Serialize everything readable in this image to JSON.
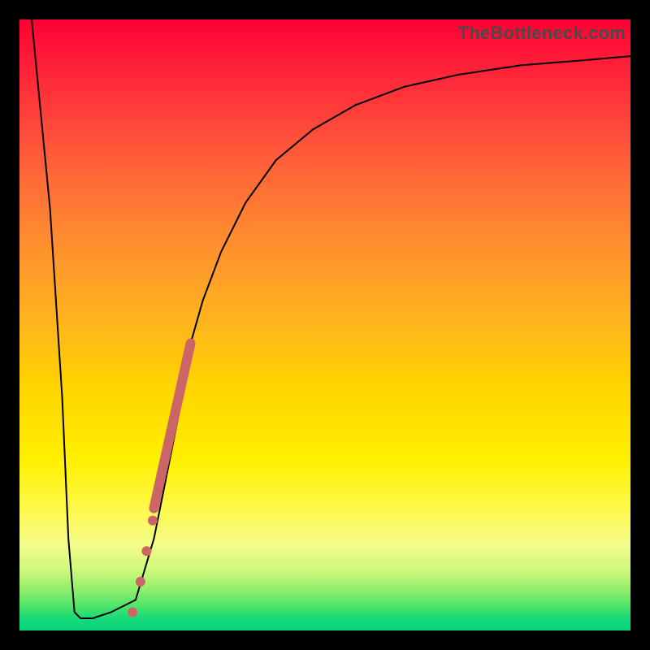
{
  "watermark": "TheBottleneck.com",
  "chart_data": {
    "type": "line",
    "title": "",
    "xlabel": "",
    "ylabel": "",
    "xlim": [
      0,
      100
    ],
    "ylim": [
      0,
      100
    ],
    "series": [
      {
        "name": "bottleneck-curve",
        "x": [
          2,
          5,
          7,
          8,
          9,
          10,
          12,
          15,
          19,
          22,
          23,
          24,
          25,
          26,
          27,
          28,
          30,
          33,
          37,
          42,
          48,
          55,
          63,
          72,
          82,
          92,
          100
        ],
        "values": [
          100,
          69,
          38,
          15,
          3,
          2,
          2,
          3,
          5,
          15,
          20,
          25,
          30,
          35,
          41,
          47,
          54,
          62,
          70,
          77,
          82,
          86,
          89,
          91,
          92.5,
          93.3,
          94
        ],
        "stroke": "#000000",
        "stroke_width": 2
      }
    ],
    "markers": {
      "name": "highlight-dots",
      "color": "#cc6666",
      "points": [
        {
          "x": 18.5,
          "y": 3,
          "r": 6
        },
        {
          "x": 19.8,
          "y": 8,
          "r": 6
        },
        {
          "x": 20.8,
          "y": 13,
          "r": 6
        },
        {
          "x": 21.8,
          "y": 18,
          "r": 6
        }
      ],
      "thick_segment": {
        "x0": 22,
        "y0": 20,
        "x1": 28,
        "y1": 47,
        "width": 12
      }
    }
  }
}
